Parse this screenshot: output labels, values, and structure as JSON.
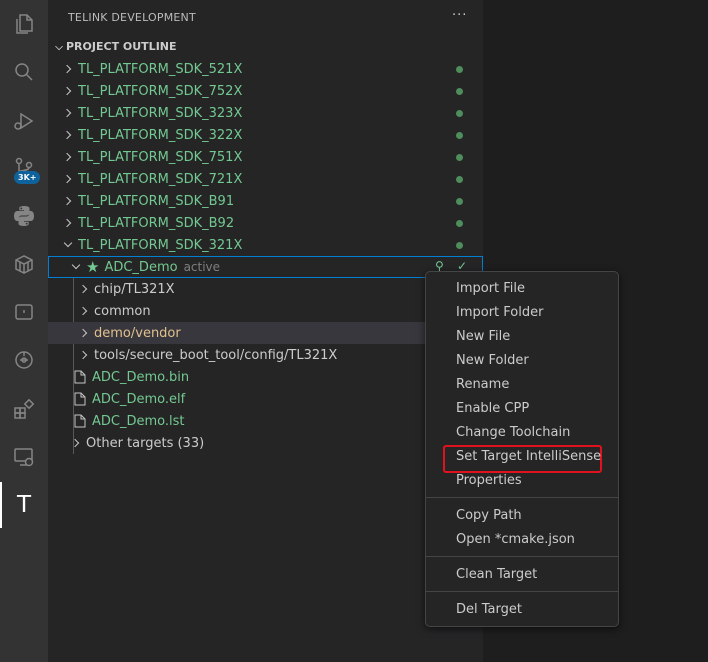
{
  "sidebar": {
    "title": "TELINK DEVELOPMENT",
    "more": "···",
    "section": "PROJECT OUTLINE",
    "sdks": [
      "TL_PLATFORM_SDK_521X",
      "TL_PLATFORM_SDK_752X",
      "TL_PLATFORM_SDK_323X",
      "TL_PLATFORM_SDK_322X",
      "TL_PLATFORM_SDK_751X",
      "TL_PLATFORM_SDK_721X",
      "TL_PLATFORM_SDK_B91",
      "TL_PLATFORM_SDK_B92",
      "TL_PLATFORM_SDK_321X"
    ],
    "target": {
      "name": "ADC_Demo",
      "status": "active",
      "check": "✓"
    },
    "folders": [
      "chip/TL321X",
      "common",
      "demo/vendor",
      "tools/secure_boot_tool/config/TL321X"
    ],
    "files": [
      "ADC_Demo.bin",
      "ADC_Demo.elf",
      "ADC_Demo.lst"
    ],
    "other_targets": "Other targets (33)"
  },
  "activity": {
    "badge": "3K+",
    "telink_letter": "T"
  },
  "context_menu": {
    "items": [
      "Import File",
      "Import Folder",
      "New File",
      "New Folder",
      "Rename",
      "Enable CPP",
      "Change Toolchain",
      "Set Target IntelliSense",
      "Properties"
    ],
    "group2": [
      "Copy Path",
      "Open *cmake.json"
    ],
    "group3": [
      "Clean Target"
    ],
    "group4": [
      "Del Target"
    ],
    "highlighted": "Set Target IntelliSense"
  },
  "colors": {
    "accent_green": "#73c991",
    "highlight_red": "#e0121e",
    "focus_blue": "#007fd4"
  }
}
